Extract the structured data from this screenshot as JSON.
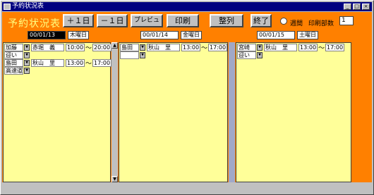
{
  "window": {
    "title": "予約状況表",
    "minimize": "_",
    "maximize": "□",
    "close": "×"
  },
  "header": {
    "title": "予約状況表",
    "plus_day": "＋１日",
    "minus_day": "－１日",
    "preview": "プレビュ",
    "print": "印刷",
    "arrange": "整列",
    "exit": "終了",
    "week_label": "週間",
    "copies_label": "印刷部数",
    "copies_value": "1"
  },
  "days": [
    {
      "date": "00/01/13",
      "dow": "木曜日",
      "rows": [
        {
          "dest": "加藤",
          "name": "赤堀　義",
          "start": "10:00",
          "end": "20:00"
        },
        {
          "dest": "迎い",
          "name": "",
          "start": "",
          "end": ""
        },
        {
          "dest": "島田",
          "name": "秋山　里",
          "start": "13:00",
          "end": "17:00"
        },
        {
          "dest": "高速道",
          "name": "",
          "start": "",
          "end": ""
        }
      ]
    },
    {
      "date": "00/01/14",
      "dow": "金曜日",
      "rows": [
        {
          "dest": "島田",
          "name": "秋山　里",
          "start": "13:00",
          "end": "17:00"
        },
        {
          "dest": "",
          "name": "",
          "start": "",
          "end": ""
        }
      ]
    },
    {
      "date": "00/01/15",
      "dow": "土曜日",
      "rows": [
        {
          "dest": "宮崎",
          "name": "秋山　里",
          "start": "13:00",
          "end": "17:00"
        },
        {
          "dest": "迎い",
          "name": "",
          "start": "",
          "end": ""
        }
      ]
    }
  ],
  "tilde": "～",
  "scroll_up": "▲",
  "scroll_down": "▼",
  "dropdown": "▼"
}
